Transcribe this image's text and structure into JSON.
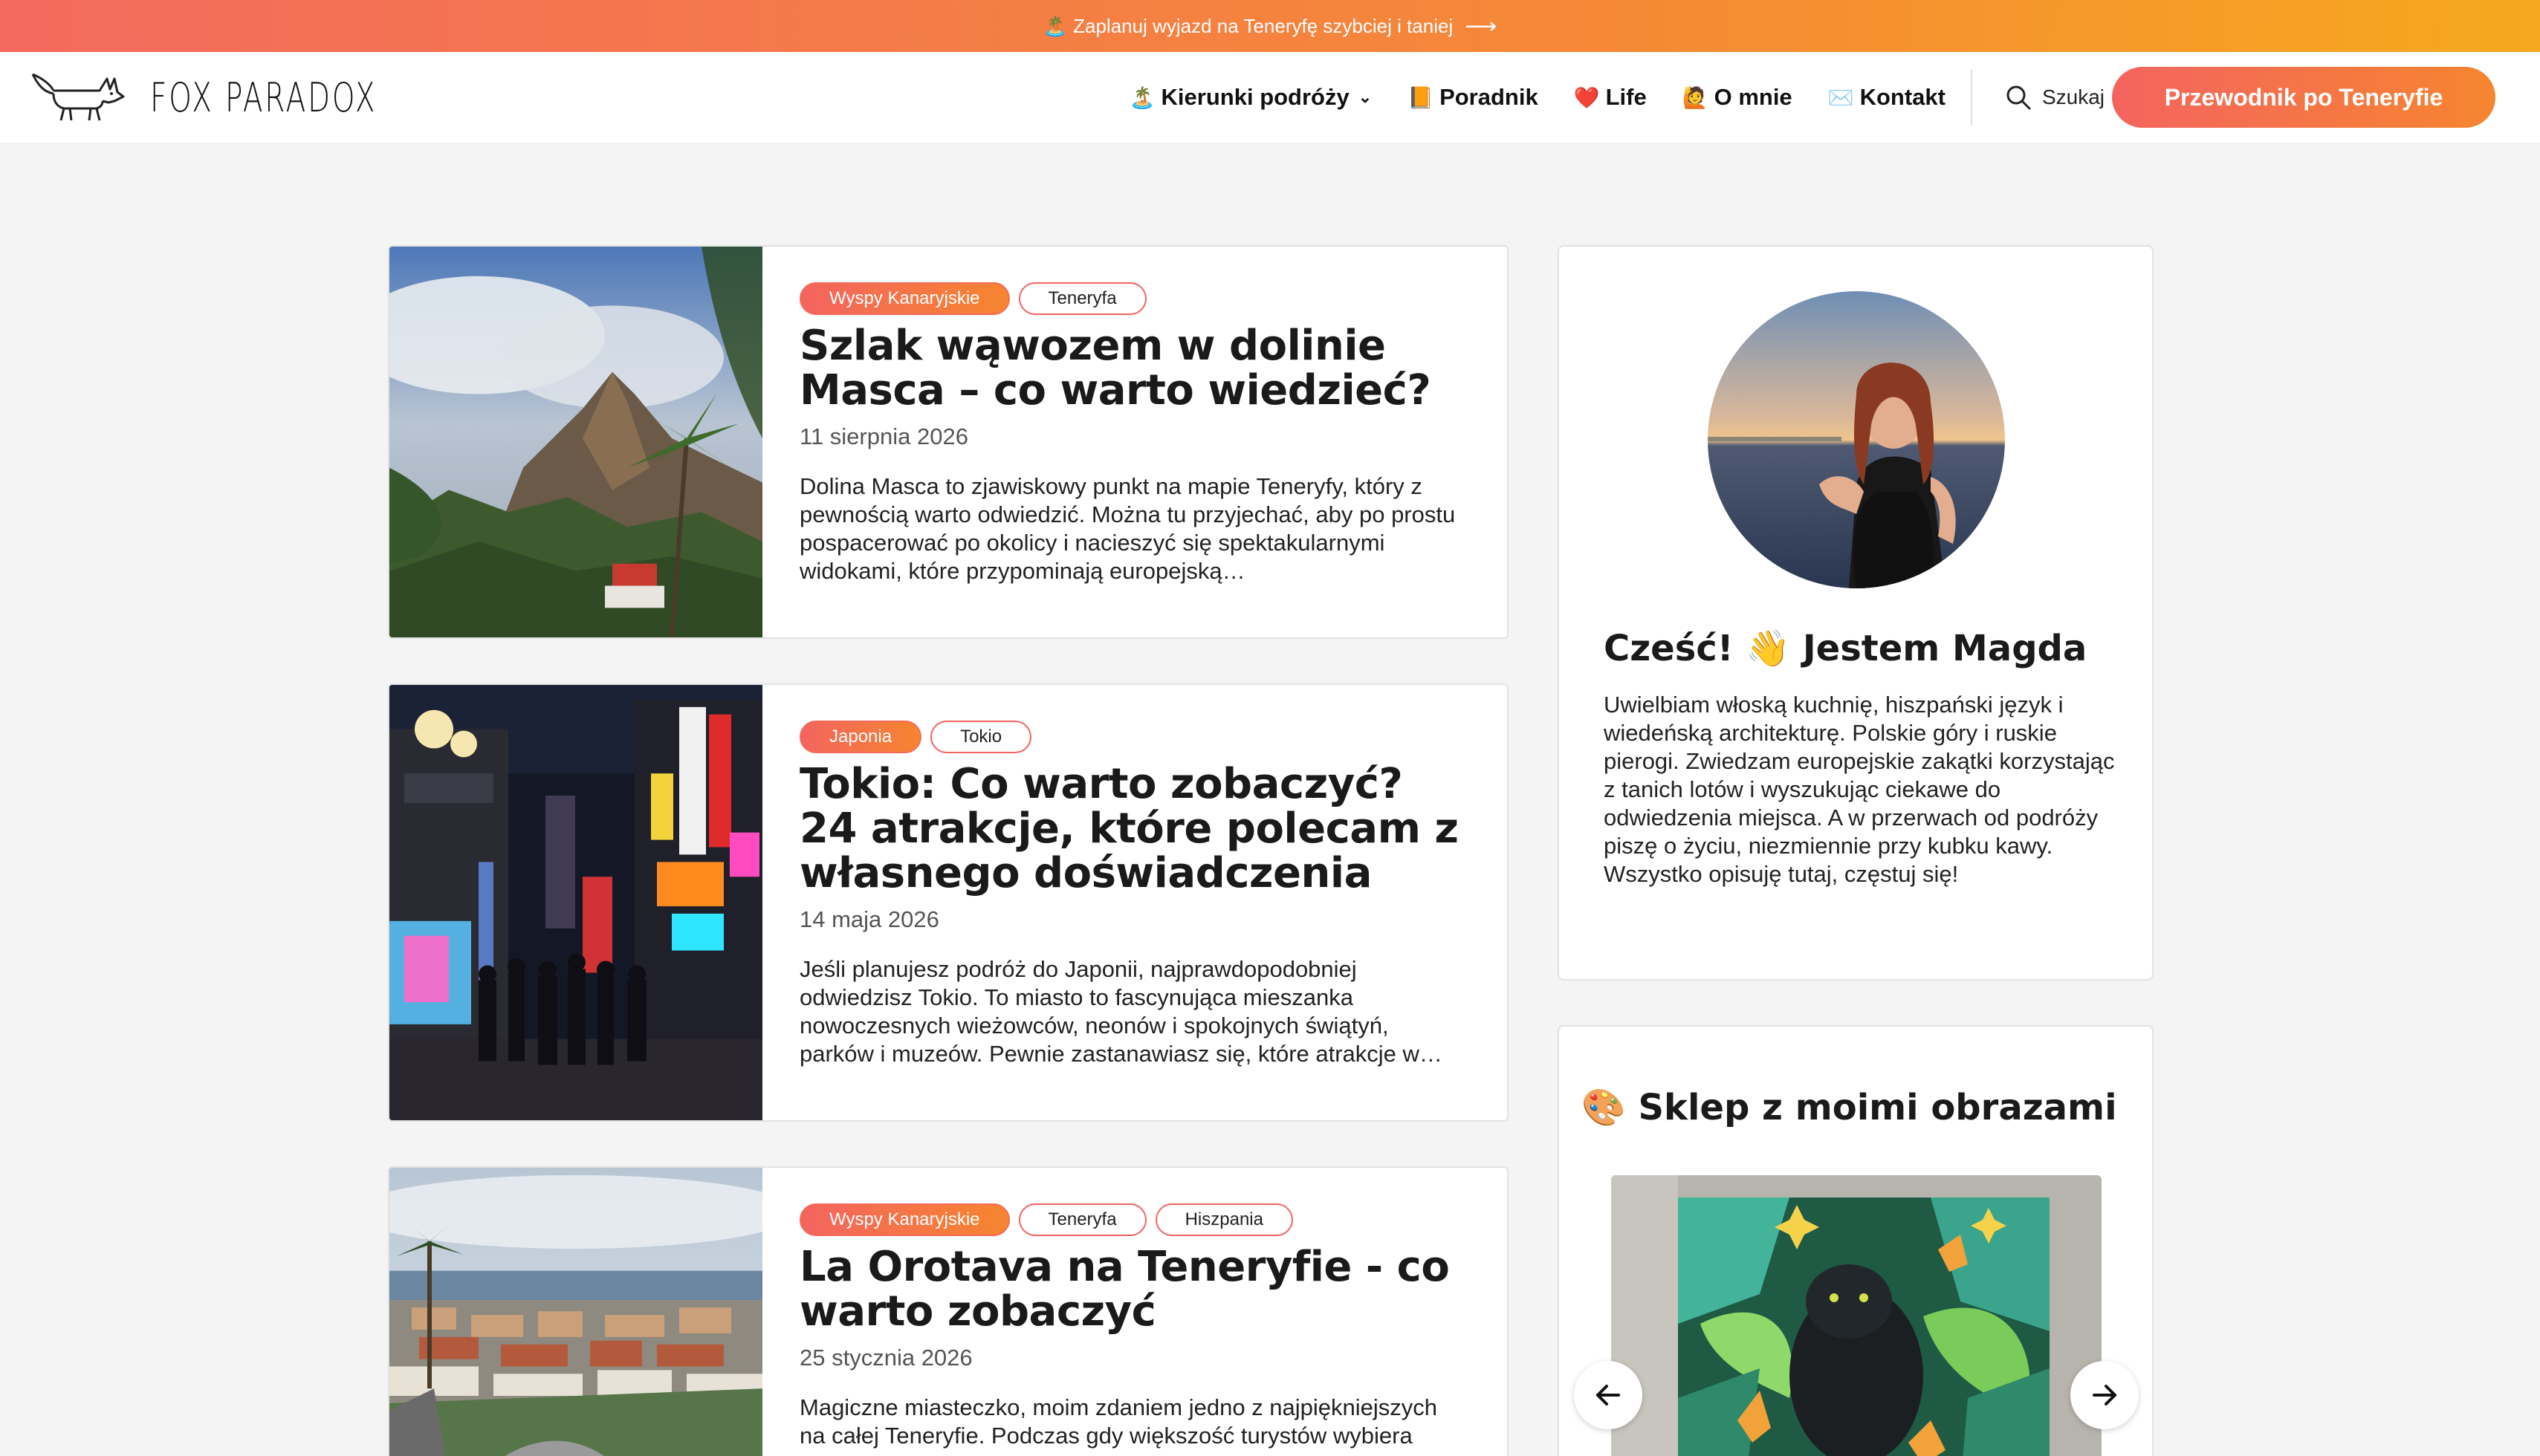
{
  "promo": {
    "emoji": "🏝️",
    "text": "Zaplanuj wyjazd na Teneryfę szybciej i taniej",
    "arrow": "⟶"
  },
  "header": {
    "logo_text": "FOX PARADOX",
    "nav": [
      {
        "emoji": "🏝️",
        "label": "Kierunki podróży",
        "chevron": "⌄"
      },
      {
        "emoji": "📙",
        "label": "Poradnik"
      },
      {
        "emoji": "❤️",
        "label": "Life"
      },
      {
        "emoji": "🙋",
        "label": "O mnie"
      },
      {
        "emoji": "✉️",
        "label": "Kontakt"
      }
    ],
    "search_label": "Szukaj",
    "cta_label": "Przewodnik po Teneryfie"
  },
  "posts": [
    {
      "tags": [
        "Wyspy Kanaryjskie",
        "Teneryfa"
      ],
      "title": "Szlak wąwozem w dolinie Masca – co warto wiedzieć?",
      "date": "11 sierpnia 2026",
      "excerpt": "Dolina Masca to zjawiskowy punkt na mapie Teneryfy, który z pewnością warto odwiedzić. Można tu przyjechać, aby po prostu pospacerować po okolicy i nacieszyć się spektakularnymi widokami, które przypominają europejską…"
    },
    {
      "tags": [
        "Japonia",
        "Tokio"
      ],
      "title": "Tokio: Co warto zobaczyć? 24 atrakcje, które polecam z własnego doświadczenia",
      "date": "14 maja 2026",
      "excerpt": "Jeśli planujesz podróż do Japonii, najprawdopodobniej odwiedzisz Tokio. To miasto to fascynująca mieszanka nowoczesnych wieżowców, neonów i spokojnych świątyń, parków i muzeów. Pewnie zastanawiasz się, które atrakcje w…"
    },
    {
      "tags": [
        "Wyspy Kanaryjskie",
        "Teneryfa",
        "Hiszpania"
      ],
      "title": "La Orotava na Teneryfie - co warto zobaczyć",
      "date": "25 stycznia 2026",
      "excerpt": "Magiczne miasteczko, moim zdaniem jedno z najpiękniejszych na całej Teneryfie. Podczas gdy większość turystów wybiera"
    }
  ],
  "sidebar": {
    "about_title": "Cześć! 👋 Jestem Magda",
    "about_text": "Uwielbiam włoską kuchnię, hiszpański język i wiedeńską architekturę. Polskie góry i ruskie pierogi. Zwiedzam europejskie zakątki korzystając z tanich lotów i wyszukując ciekawe do odwiedzenia miejsca. A w przerwach od podróży piszę o życiu, niezmiennie przy kubku kawy. Wszystko opisuję tutaj, częstuj się!",
    "shop_title": "🎨 Sklep z moimi obrazami"
  },
  "colors": {
    "accent_start": "#f4645f",
    "accent_end": "#f6852f"
  }
}
